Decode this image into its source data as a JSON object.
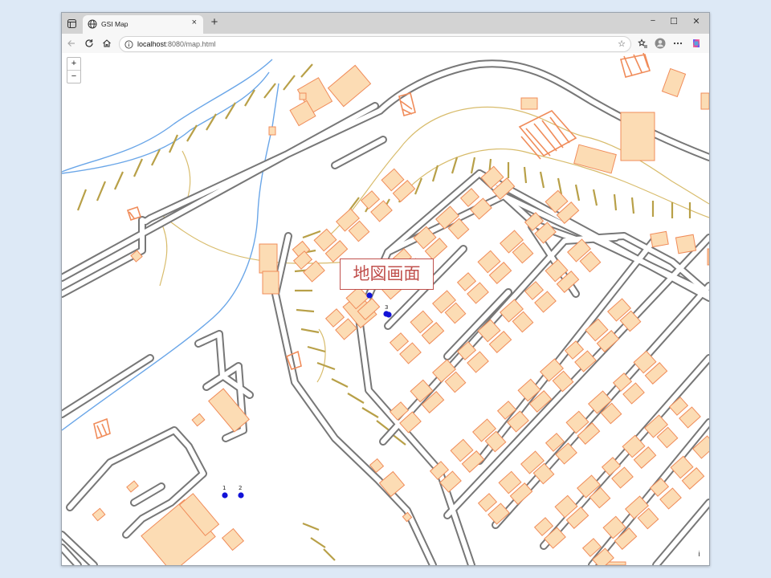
{
  "browser": {
    "tab_title": "GSI Map",
    "url_host": "localhost",
    "url_rest": ":8080/map.html",
    "new_tab": "+",
    "tab_close": "×"
  },
  "window_controls": {
    "minimize": "−",
    "maximize": "☐",
    "close": "✕"
  },
  "map": {
    "zoom_in": "+",
    "zoom_out": "−",
    "attribution": "i",
    "markers": [
      {
        "label": "1"
      },
      {
        "label": "2"
      },
      {
        "label": "3"
      }
    ]
  },
  "annotation": {
    "callout": "地図画面"
  },
  "colors": {
    "road_outline": "#777777",
    "building_fill": "#fcdcb4",
    "building_outline": "#f08c5a",
    "water": "#6aa6e8",
    "contour": "#d8bc6c",
    "slope": "#b8a048",
    "marker": "#1212d8",
    "callout": "#c0504d"
  }
}
